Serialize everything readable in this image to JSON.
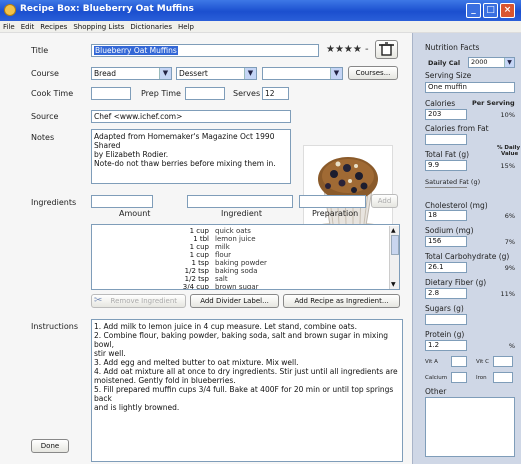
{
  "window": {
    "title": "Recipe Box: Blueberry Oat Muffins"
  },
  "menu": [
    "File",
    "Edit",
    "Recipes",
    "Shopping Lists",
    "Dictionaries",
    "Help"
  ],
  "recipe": {
    "title_label": "Title",
    "title_value": "Blueberry Oat Muffins",
    "rating_text": "★★★★ -",
    "course_label": "Course",
    "course_value": "Bread",
    "category_value": "Dessert",
    "third_value": "",
    "courses_button": "Courses...",
    "cook_time_label": "Cook Time",
    "cook_time_value": "",
    "prep_time_label": "Prep Time",
    "prep_time_value": "",
    "serves_label": "Serves",
    "serves_value": "12",
    "source_label": "Source",
    "source_value": "Chef <www.ichef.com>",
    "notes_label": "Notes",
    "notes_lines": [
      "Adapted from Homemaker's Magazine Oct 1990 Shared",
      "by Elizabeth Rodier.",
      "Note-do not thaw berries before mixing them in."
    ]
  },
  "ingredients": {
    "label": "Ingredients",
    "amount_header": "Amount",
    "ingredient_header": "Ingredient",
    "preparation_header": "Preparation",
    "add_button": "Add",
    "rows": [
      {
        "amount": "1 cup",
        "name": "quick oats"
      },
      {
        "amount": "1 tbl",
        "name": "lemon juice"
      },
      {
        "amount": "1 cup",
        "name": "milk"
      },
      {
        "amount": "1 cup",
        "name": "flour"
      },
      {
        "amount": "1 tsp",
        "name": "baking powder"
      },
      {
        "amount": "1/2 tsp",
        "name": "baking soda"
      },
      {
        "amount": "1/2 tsp",
        "name": "salt"
      },
      {
        "amount": "3/4 cup",
        "name": "brown sugar"
      }
    ],
    "remove_button": "Remove Ingredient",
    "divider_button": "Add Divider Label...",
    "recipe_as_ingredient_button": "Add Recipe as Ingredient..."
  },
  "instructions": {
    "label": "Instructions",
    "lines": [
      "1. Add milk to lemon juice in 4 cup measure. Let stand, combine oats.",
      "2. Combine flour, baking powder, baking soda, salt and brown sugar in mixing bowl,",
      "stir well.",
      "3. Add egg and melted butter to oat mixture. Mix well.",
      "4. Add oat mixture all at once to dry ingredients. Stir just until all ingredients are",
      "moistened. Gently fold in blueberries.",
      "5. Fill prepared muffin cups 3/4 full. Bake at 400F for 20 min or until top springs back",
      "and is lightly browned."
    ],
    "done_button": "Done"
  },
  "nutrition": {
    "heading": "Nutrition Facts",
    "daily_cal_label": "Daily Cal",
    "daily_cal_value": "2000",
    "serving_size_label": "Serving Size",
    "serving_size_value": "One muffin",
    "calories_label": "Calories",
    "per_serving_label": "Per Serving",
    "calories_value": "203",
    "calories_pct": "10%",
    "calories_fat_label": "Calories from Fat",
    "calories_fat_value": "",
    "total_fat_label": "Total Fat (g)",
    "daily_value_label_1": "% Daily",
    "daily_value_label_2": "Value",
    "total_fat_value": "9.9",
    "total_fat_pct": "15%",
    "saturated_fat_label": "Saturated Fat (g)",
    "cholesterol_label": "Cholesterol (mg)",
    "cholesterol_value": "18",
    "cholesterol_pct": "6%",
    "sodium_label": "Sodium (mg)",
    "sodium_value": "156",
    "sodium_pct": "7%",
    "carb_label": "Total Carbohydrate (g)",
    "carb_value": "26.1",
    "carb_pct": "9%",
    "fiber_label": "Dietary Fiber (g)",
    "fiber_value": "2.8",
    "fiber_pct": "11%",
    "sugars_label": "Sugars (g)",
    "sugars_value": "",
    "protein_label": "Protein (g)",
    "protein_value": "1.2",
    "protein_pct": "%",
    "vit_a_label": "Vit A",
    "vit_c_label": "Vit C",
    "calcium_label": "Calcium",
    "iron_label": "Iron",
    "other_label": "Other"
  }
}
